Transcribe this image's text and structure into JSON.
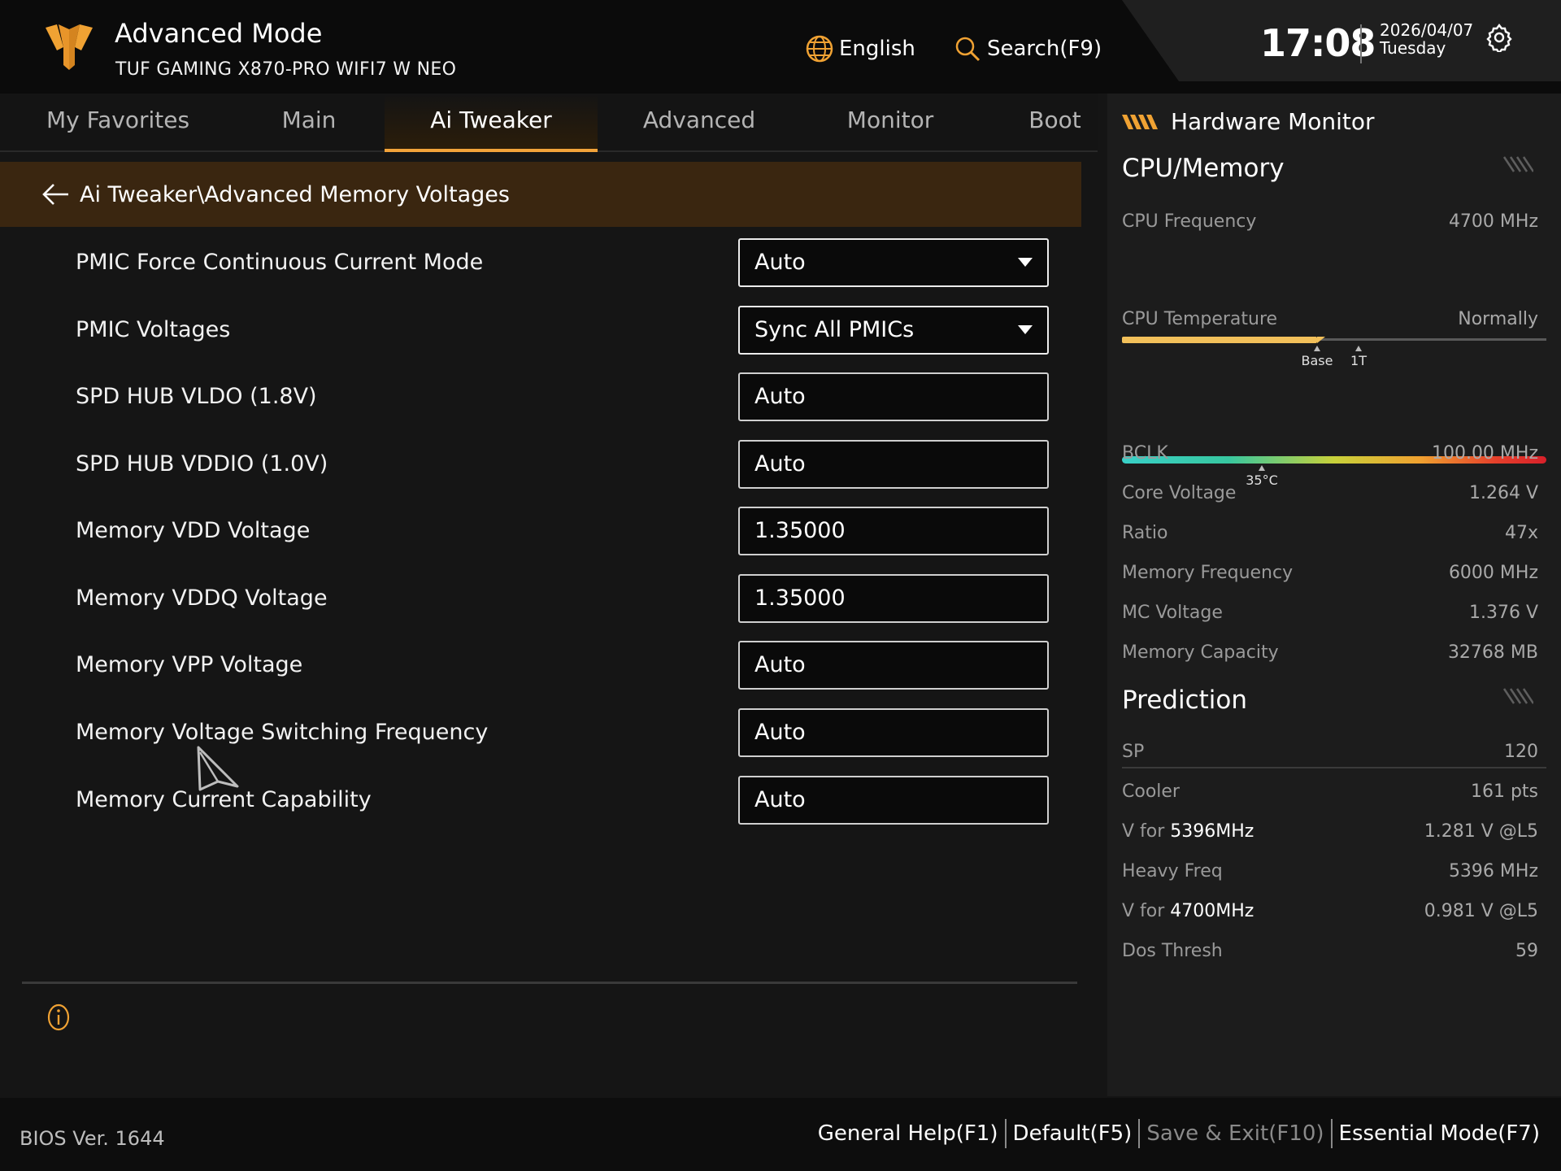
{
  "header": {
    "mode_title": "Advanced Mode",
    "board_name": "TUF GAMING X870-PRO WIFI7 W NEO",
    "language": "English",
    "search": "Search(F9)",
    "time": "17:08",
    "date": "2026/04/07",
    "weekday": "Tuesday"
  },
  "tabs": [
    {
      "label": "My Favorites"
    },
    {
      "label": "Main"
    },
    {
      "label": "Ai Tweaker",
      "active": true
    },
    {
      "label": "Advanced"
    },
    {
      "label": "Monitor"
    },
    {
      "label": "Boot"
    }
  ],
  "breadcrumb": "Ai Tweaker\\Advanced Memory Voltages",
  "settings": [
    {
      "label": "PMIC Force Continuous Current Mode",
      "value": "Auto",
      "type": "dropdown"
    },
    {
      "label": "PMIC Voltages",
      "value": "Sync All PMICs",
      "type": "dropdown"
    },
    {
      "label": "SPD HUB VLDO (1.8V)",
      "value": "Auto",
      "type": "input"
    },
    {
      "label": "SPD HUB VDDIO (1.0V)",
      "value": "Auto",
      "type": "input"
    },
    {
      "label": "Memory VDD Voltage",
      "value": "1.35000",
      "type": "input"
    },
    {
      "label": "Memory VDDQ Voltage",
      "value": "1.35000",
      "type": "input"
    },
    {
      "label": "Memory VPP Voltage",
      "value": "Auto",
      "type": "input"
    },
    {
      "label": "Memory Voltage Switching Frequency",
      "value": "Auto",
      "type": "input"
    },
    {
      "label": "Memory Current Capability",
      "value": "Auto",
      "type": "input"
    }
  ],
  "hw_monitor": {
    "title": "Hardware Monitor",
    "cpu_memory_title": "CPU/Memory",
    "cpu_frequency": {
      "label": "CPU Frequency",
      "value": "4700 MHz",
      "fill_fraction": 0.46,
      "marker_base": "Base",
      "marker_1t": "1T"
    },
    "cpu_temperature": {
      "label": "CPU Temperature",
      "value": "Normally",
      "marker": "35°C"
    },
    "rows": [
      {
        "label": "BCLK",
        "value": "100.00 MHz"
      },
      {
        "label": "Core Voltage",
        "value": "1.264 V"
      },
      {
        "label": "Ratio",
        "value": "47x"
      },
      {
        "label": "Memory Frequency",
        "value": "6000 MHz"
      },
      {
        "label": "MC Voltage",
        "value": "1.376 V"
      },
      {
        "label": "Memory Capacity",
        "value": "32768 MB"
      }
    ],
    "prediction_title": "Prediction",
    "prediction": [
      {
        "label": "SP",
        "value": "120"
      },
      {
        "label": "Cooler",
        "value": "161 pts"
      },
      {
        "label": "V for ",
        "label_bold": "5396MHz",
        "value": "1.281 V @L5"
      },
      {
        "label": "Heavy Freq",
        "value": "5396 MHz"
      },
      {
        "label": "V for ",
        "label_bold": "4700MHz",
        "value": "0.981 V @L5"
      },
      {
        "label": "Dos Thresh",
        "value": "59"
      }
    ]
  },
  "footer": {
    "bios_version": "BIOS Ver. 1644",
    "keys": [
      {
        "label": "General Help(F1)",
        "dim": false
      },
      {
        "label": "Default(F5)",
        "dim": false
      },
      {
        "label": "Save & Exit(F10)",
        "dim": true
      },
      {
        "label": "Essential Mode(F7)",
        "dim": false
      }
    ]
  },
  "colors": {
    "accent": "#f2a33a",
    "breadcrumb_bg": "#3a2610",
    "background": "#151515"
  }
}
